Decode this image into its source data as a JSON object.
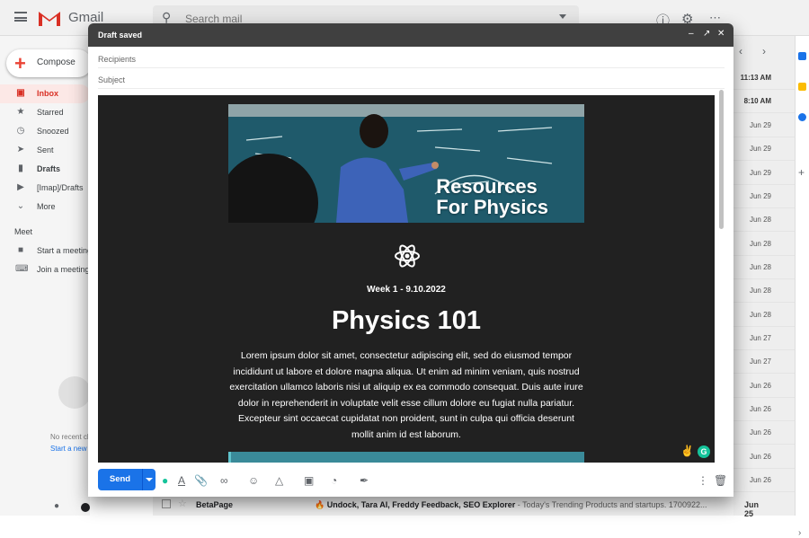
{
  "app": {
    "title": "Gmail",
    "search_placeholder": "Search mail"
  },
  "compose_button": "Compose",
  "nav": [
    {
      "label": "Inbox",
      "icon": "inbox-icon",
      "active": true
    },
    {
      "label": "Starred",
      "icon": "star-icon"
    },
    {
      "label": "Snoozed",
      "icon": "clock-icon"
    },
    {
      "label": "Sent",
      "icon": "send-icon"
    },
    {
      "label": "Drafts",
      "icon": "draft-icon"
    },
    {
      "label": "[Imap]/Drafts",
      "icon": "label-icon"
    },
    {
      "label": "More",
      "icon": "chevron-down-icon"
    }
  ],
  "meet": {
    "title": "Meet",
    "start": "Start a meeting",
    "join": "Join a meeting"
  },
  "hangouts": {
    "no_recent": "No recent chats",
    "start_new": "Start a new one"
  },
  "mail_dates": [
    "11:13 AM",
    "8:10 AM",
    "Jun 29",
    "Jun 29",
    "Jun 29",
    "Jun 29",
    "Jun 28",
    "Jun 28",
    "Jun 28",
    "Jun 28",
    "Jun 28",
    "Jun 27",
    "Jun 27",
    "Jun 26",
    "Jun 26",
    "Jun 26",
    "Jun 26",
    "Jun 26",
    "Jun 25"
  ],
  "bottom_row": {
    "sender": "BetaPage",
    "subject": "🔥 Undock, Tara AI, Freddy Feedback, SEO Explorer",
    "snippet": " - Today's Trending Products and startups. 1700922...",
    "date": "Jun 25"
  },
  "dialog": {
    "title": "Draft saved",
    "recipients_label": "Recipients",
    "subject_label": "Subject",
    "hero_title_line1": "Resources",
    "hero_title_line2": "For Physics",
    "week": "Week 1 - 9.10.2022",
    "heading": "Physics 101",
    "body_text": "Lorem ipsum dolor sit amet, consectetur adipiscing elit, sed do eiusmod tempor incididunt ut labore et dolore magna aliqua. Ut enim ad minim veniam, quis nostrud exercitation ullamco laboris nisi ut aliquip ex ea commodo consequat. Duis aute irure dolor in reprehenderit in voluptate velit esse cillum dolore eu fugiat nulla pariatur. Excepteur sint occaecat cupidatat non proident, sunt in culpa qui officia deserunt mollit anim id est laborum.",
    "send_label": "Send"
  },
  "colors": {
    "gmail_red": "#d93025",
    "send_blue": "#1a73e8",
    "dialog_header": "#404040",
    "email_bg": "#212121",
    "teal": "#3a8a99"
  }
}
